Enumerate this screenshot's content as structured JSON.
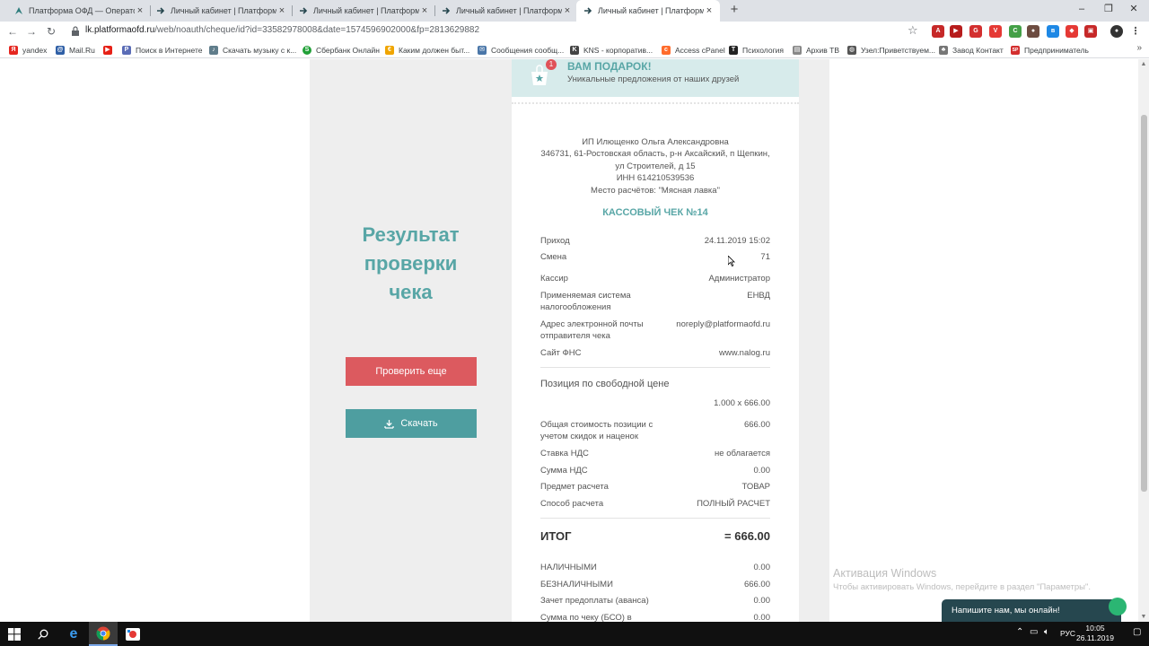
{
  "tabs": [
    {
      "label": "Платформа ОФД — Оператор ф",
      "close": "×"
    },
    {
      "label": "Личный кабинет | Платформа О",
      "close": "×"
    },
    {
      "label": "Личный кабинет | Платформа О",
      "close": "×"
    },
    {
      "label": "Личный кабинет | Платформа О",
      "close": "×"
    },
    {
      "label": "Личный кабинет | Платформа О",
      "close": "×"
    }
  ],
  "window": {
    "minimize": "–",
    "restore": "❐",
    "close": "✕",
    "new_tab": "+"
  },
  "address": {
    "host": "lk.platformaofd.ru",
    "path": "/web/noauth/cheque/id?id=33582978008&date=1574596902000&fp=2813629882"
  },
  "bookmarks": [
    {
      "label": "yandex",
      "color": "#e52620",
      "icon": "Я"
    },
    {
      "label": "Mail.Ru",
      "color": "#2f5fa6",
      "icon": "@"
    },
    {
      "label": "",
      "color": "#e62117",
      "icon": "▶"
    },
    {
      "label": "Поиск в Интернете",
      "color": "#5a6cb6",
      "icon": "P"
    },
    {
      "label": "Скачать музыку с к...",
      "color": "#607d8b",
      "icon": "♪"
    },
    {
      "label": "Сбербанк Онлайн",
      "color": "#21a038",
      "icon": "S"
    },
    {
      "label": "Каким должен быт...",
      "color": "#f0a500",
      "icon": "€"
    },
    {
      "label": "Сообщения сообщ...",
      "color": "#4a76a8",
      "icon": "✉"
    },
    {
      "label": "KNS - корпоратив...",
      "color": "#444444",
      "icon": "K"
    },
    {
      "label": "Access cPanel",
      "color": "#ff6c2c",
      "icon": "c"
    },
    {
      "label": "Психология",
      "color": "#222222",
      "icon": "T"
    },
    {
      "label": "Архив ТВ",
      "color": "#888888",
      "icon": "▤"
    },
    {
      "label": "Узел:Приветствуем...",
      "color": "#555555",
      "icon": "◍"
    },
    {
      "label": "Завод Контакт",
      "color": "#777777",
      "icon": "♣"
    },
    {
      "label": "Предприниматель",
      "color": "#d32f2f",
      "icon": "SP"
    }
  ],
  "bookmarks_more": "»",
  "gift": {
    "title": "ВАМ ПОДАРОК!",
    "subtitle": "Уникальные предложения от наших друзей",
    "badge": "1"
  },
  "left": {
    "title_line1": "Результат",
    "title_line2": "проверки",
    "title_line3": "чека",
    "check_again": "Проверить еще",
    "download": "Скачать"
  },
  "receipt": {
    "org_name": "ИП Илющенко Ольга Александровна",
    "address1": "346731, 61-Ростовская область, р-н Аксайский, п Щепкин,",
    "address2": "ул Строителей, д 15",
    "inn": "ИНН 614210539536",
    "place": "Место расчётов: \"Мясная лавка\"",
    "title": "КАССОВЫЙ ЧЕК №14",
    "rows": [
      {
        "k": "Приход",
        "v": "24.11.2019 15:02"
      },
      {
        "k": "Смена",
        "v": "71"
      },
      {
        "k": "Кассир",
        "v": "Администратор"
      },
      {
        "k": "Применяемая система налогообложения",
        "v": "ЕНВД"
      },
      {
        "k": "Адрес электронной почты отправителя чека",
        "v": "noreply@platformaofd.ru"
      },
      {
        "k": "Сайт ФНС",
        "v": "www.nalog.ru"
      }
    ],
    "position_title": "Позиция по свободной цене",
    "quantity": "1.000 x 666.00",
    "position_rows": [
      {
        "k": "Общая стоимость позиции с учетом скидок и наценок",
        "v": "666.00"
      },
      {
        "k": "Ставка НДС",
        "v": "не облагается"
      },
      {
        "k": "Сумма НДС",
        "v": "0.00"
      },
      {
        "k": "Предмет расчета",
        "v": "ТОВАР"
      },
      {
        "k": "Способ расчета",
        "v": "ПОЛНЫЙ РАСЧЕТ"
      }
    ],
    "total_label": "ИТОГ",
    "total_value": "= 666.00",
    "pay_rows": [
      {
        "k": "НАЛИЧНЫМИ",
        "v": "0.00"
      },
      {
        "k": "БЕЗНАЛИЧНЫМИ",
        "v": "666.00"
      },
      {
        "k": "Зачет предоплаты (аванса)",
        "v": "0.00"
      },
      {
        "k": "Сумма по чеку (БСО) в",
        "v": "0.00"
      }
    ]
  },
  "watermark": {
    "line1": "Активация Windows",
    "line2": "Чтобы активировать Windows, перейдите в раздел \"Параметры\"."
  },
  "chat": {
    "label": "Напишите нам, мы онлайн!"
  },
  "taskbar": {
    "lang": "РУС",
    "time": "10:05",
    "date": "26.11.2019"
  }
}
